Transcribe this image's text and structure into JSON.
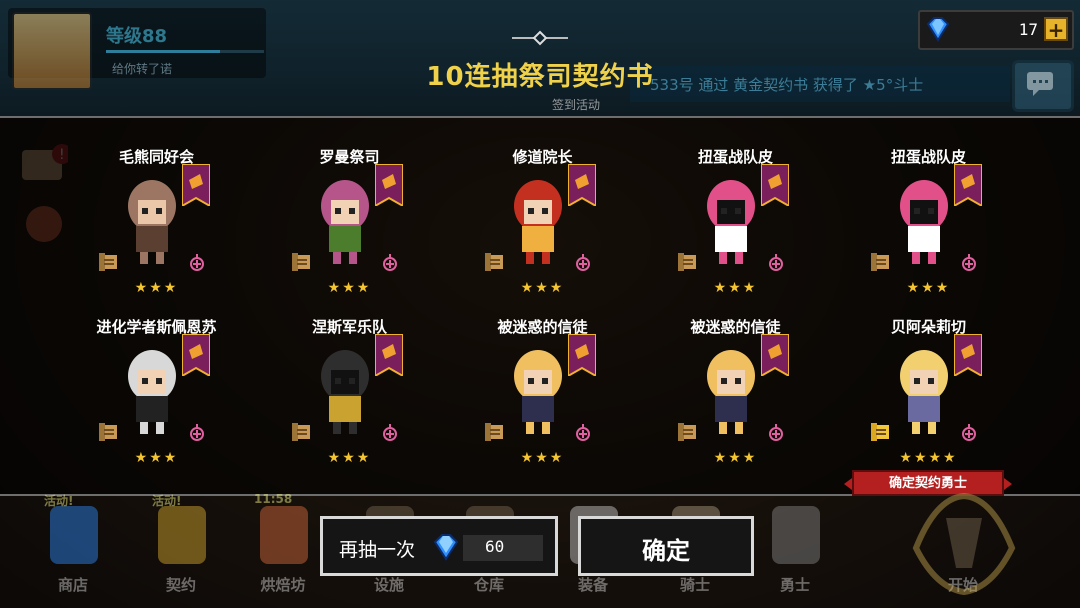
{
  "player": {
    "level_label": "等级88",
    "subtitle": "给你转了诺"
  },
  "currency": {
    "gems": "17",
    "plus": "+"
  },
  "ticker": {
    "text": "533号 通过 黄金契约书 获得了 ★5°斗士"
  },
  "title": "10连抽祭司契约书",
  "checkin_label": "签到活动",
  "cards": [
    {
      "name": "毛熊同好会",
      "stars": "★★★",
      "sprite": "bear-girl"
    },
    {
      "name": "罗曼祭司",
      "stars": "★★★",
      "sprite": "priestess"
    },
    {
      "name": "修道院长",
      "stars": "★★★",
      "sprite": "abbess"
    },
    {
      "name": "扭蛋战队皮",
      "stars": "★★★",
      "sprite": "pink-ranger"
    },
    {
      "name": "扭蛋战队皮",
      "stars": "★★★",
      "sprite": "pink-ranger"
    },
    {
      "name": "进化学者斯佩恩苏",
      "stars": "★★★",
      "sprite": "old-scholar"
    },
    {
      "name": "涅斯军乐队",
      "stars": "★★★",
      "sprite": "officer"
    },
    {
      "name": "被迷惑的信徒",
      "stars": "★★★",
      "sprite": "blond-believer"
    },
    {
      "name": "被迷惑的信徒",
      "stars": "★★★",
      "sprite": "blond-believer"
    },
    {
      "name": "贝阿朵莉切",
      "stars": "★★★★",
      "sprite": "blonde-girl"
    }
  ],
  "legendary_tag": "确定契约勇士",
  "buttons": {
    "retry_label": "再抽一次",
    "retry_cost": "60",
    "confirm_label": "确定"
  },
  "nav": [
    {
      "label": "商店",
      "badge": "活动!"
    },
    {
      "label": "契约",
      "badge": "活动!"
    },
    {
      "label": "烘焙坊",
      "badge": "11:58"
    },
    {
      "label": "设施",
      "badge": ""
    },
    {
      "label": "仓库",
      "badge": ""
    },
    {
      "label": "装备",
      "badge": ""
    },
    {
      "label": "骑士",
      "badge": ""
    },
    {
      "label": "勇士",
      "badge": ""
    },
    {
      "label": "开始",
      "badge": ""
    }
  ],
  "colors": {
    "title": "#f0d24a",
    "star": "#f4c531",
    "tag": "#b3201f",
    "banner": "#7a1f5c"
  }
}
